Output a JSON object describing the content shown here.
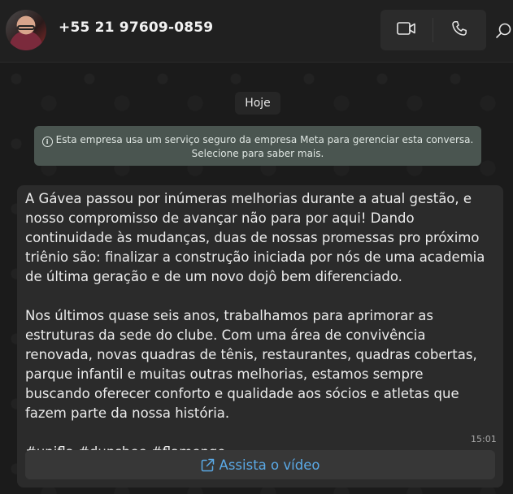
{
  "header": {
    "contact_name": "+55 21 97609-0859",
    "video_call_icon": "video-camera-icon",
    "voice_call_icon": "phone-icon",
    "search_icon": "search-icon"
  },
  "chat": {
    "date_label": "Hoje",
    "info_banner": {
      "icon": "info-icon",
      "line1": "Esta empresa usa um serviço seguro da empresa Meta para gerenciar esta conversa.",
      "line2": "Selecione para saber mais."
    },
    "message": {
      "paragraph1": "A Gávea passou por inúmeras melhorias durante a atual gestão, e nosso compromisso de avançar não para por aqui! Dando continuidade às mudanças, duas de nossas promessas pro próximo triênio são: finalizar a construção iniciada por nós de uma academia de última geração e de um novo dojô bem diferenciado.",
      "paragraph2": "Nos últimos quase seis anos, trabalhamos para aprimorar as estruturas da sede do clube. Com uma área de convivência renovada, novas quadras de tênis, restaurantes, quadras cobertas, parque infantil e muitas outras melhorias, estamos sempre buscando oferecer conforto e qualidade aos sócios e atletas que fazem parte da nossa história.",
      "hashtags": "#unifla #dunshee #flamengo",
      "time": "15:01",
      "cta_label": "Assista o vídeo",
      "cta_icon": "external-link-icon"
    }
  },
  "colors": {
    "link": "#5aa9e6",
    "bubble": "#2b2b2b",
    "banner": "#4a5550"
  }
}
